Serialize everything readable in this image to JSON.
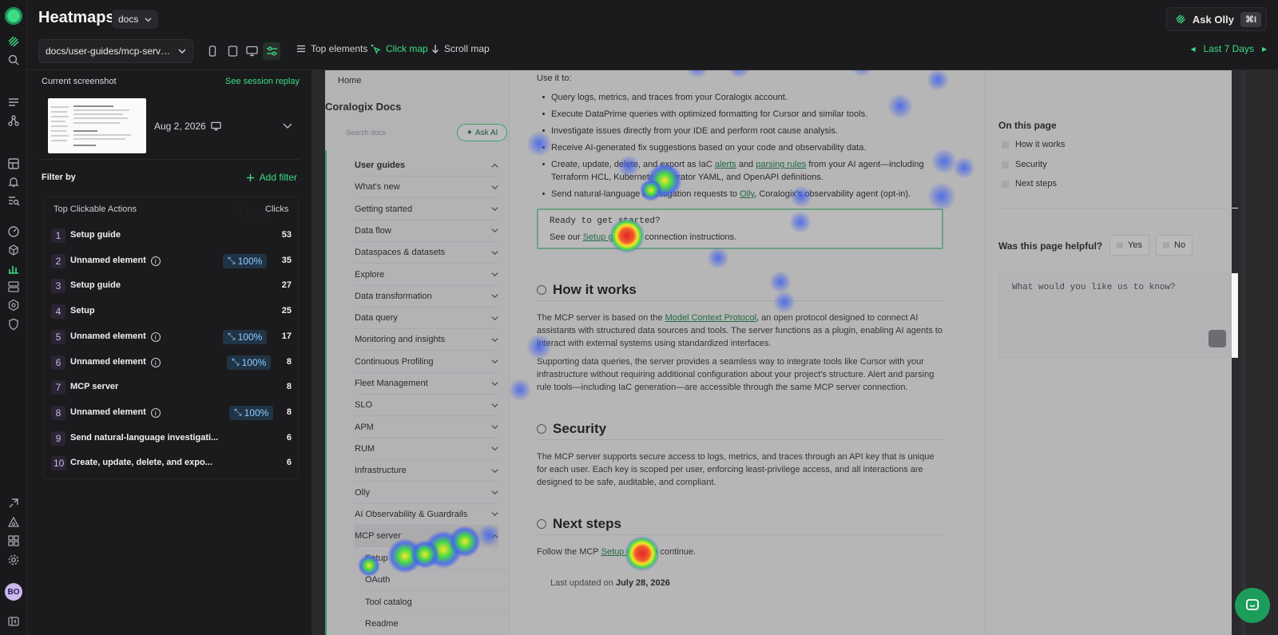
{
  "app": {
    "title": "Heatmaps",
    "scope": "docs",
    "ask_olly": "Ask Olly",
    "ask_olly_shortcut": "⌘I",
    "avatar_initials": "BO",
    "accent_color": "#3ddc84"
  },
  "toolbar": {
    "path": "docs/user-guides/mcp-server/ove...",
    "modes": [
      "Top elements",
      "Click map",
      "Scroll map"
    ],
    "active_mode": "Click map",
    "date_range": "Last 7 Days"
  },
  "panel": {
    "current_screenshot_label": "Current screenshot",
    "session_replay_link": "See session replay",
    "snapshot_date": "Aug 2, 2026",
    "filter_by_label": "Filter by",
    "add_filter_label": "Add filter",
    "table_headers": [
      "Top Clickable Actions",
      "Type",
      "Clicks"
    ],
    "actions": [
      {
        "rank": "1",
        "label": "Setup guide",
        "badge": "",
        "clicks": "53"
      },
      {
        "rank": "2",
        "label": "Unnamed element",
        "badge": "100%",
        "clicks": "35"
      },
      {
        "rank": "3",
        "label": "Setup guide",
        "badge": "",
        "clicks": "27"
      },
      {
        "rank": "4",
        "label": "Setup",
        "badge": "",
        "clicks": "25"
      },
      {
        "rank": "5",
        "label": "Unnamed element",
        "badge": "100%",
        "clicks": "17"
      },
      {
        "rank": "6",
        "label": "Unnamed element",
        "badge": "100%",
        "clicks": "8"
      },
      {
        "rank": "7",
        "label": "MCP server",
        "badge": "",
        "clicks": "8"
      },
      {
        "rank": "8",
        "label": "Unnamed element",
        "badge": "100%",
        "clicks": "8"
      },
      {
        "rank": "9",
        "label": "Send natural-language investigati...",
        "badge": "",
        "clicks": "6"
      },
      {
        "rank": "10",
        "label": "Create, update, delete, and expo...",
        "badge": "",
        "clicks": "6"
      }
    ]
  },
  "site": {
    "home": "Home",
    "docs_title": "Coralogix Docs",
    "search_placeholder": "Search docs",
    "ask_ai": "Ask AI",
    "nav": [
      "User guides",
      "What's new",
      "Getting started",
      "Data flow",
      "Dataspaces & datasets",
      "Explore",
      "Data transformation",
      "Data query",
      "Monitoring and insights",
      "Continuous Profiling",
      "Fleet Management",
      "SLO",
      "APM",
      "RUM",
      "Infrastructure",
      "Olly",
      "AI Observability & Guardrails",
      "MCP server"
    ],
    "nav_sub": [
      "Setup",
      "OAuth",
      "Tool catalog",
      "Readme"
    ],
    "use_it_to": "Use it to:",
    "bullets": {
      "b1": "Query logs, metrics, and traces from your Coralogix account.",
      "b2": "Execute DataPrime queries with optimized formatting for Cursor and similar tools.",
      "b3": "Investigate issues directly from your IDE and perform root cause analysis.",
      "b4": "Receive AI-generated fix suggestions based on your code and observability data.",
      "b5_pre": "Create, update, delete, and export as IaC ",
      "b5_link1": "alerts",
      "b5_mid": " and ",
      "b5_link2": "parsing rules",
      "b5_post": " from your AI agent—including Terraform HCL, Kubernetes Operator YAML, and OpenAPI definitions.",
      "b6_pre": "Send natural-language investigation requests to ",
      "b6_link": "Olly",
      "b6_post": ", Coralogix's observability agent (opt-in)."
    },
    "callout_title": "Ready to get started?",
    "callout_pre": "See our ",
    "callout_link": "Setup guide",
    "callout_post": " for connection instructions.",
    "h_how": "How it works",
    "how_p1_pre": "The MCP server is based on the ",
    "how_p1_link": "Model Context Protocol",
    "how_p1_post": ", an open protocol designed to connect AI assistants with structured data sources and tools. The server functions as a plugin, enabling AI agents to interact with external systems using standardized interfaces.",
    "how_p2": "Supporting data queries, the server provides a seamless way to integrate tools like Cursor with your infrastructure without requiring additional configuration about your project's structure. Alert and parsing rule tools—including IaC generation—are accessible through the same MCP server connection.",
    "h_security": "Security",
    "security_p": "The MCP server supports secure access to logs, metrics, and traces through an API key that is unique for each user. Each key is scoped per user, enforcing least-privilege access, and all interactions are designed to be safe, auditable, and compliant.",
    "h_next": "Next steps",
    "next_pre": "Follow the MCP ",
    "next_link": "Setup guide",
    "next_post": " to continue.",
    "updated_pre": "Last updated on ",
    "updated_date": "July 28, 2026",
    "toc_title": "On this page",
    "toc": [
      "How it works",
      "Security",
      "Next steps"
    ],
    "helpful": "Was this page helpful?",
    "yes": "Yes",
    "no": "No",
    "feedback_placeholder": "What would you like us to know?"
  }
}
